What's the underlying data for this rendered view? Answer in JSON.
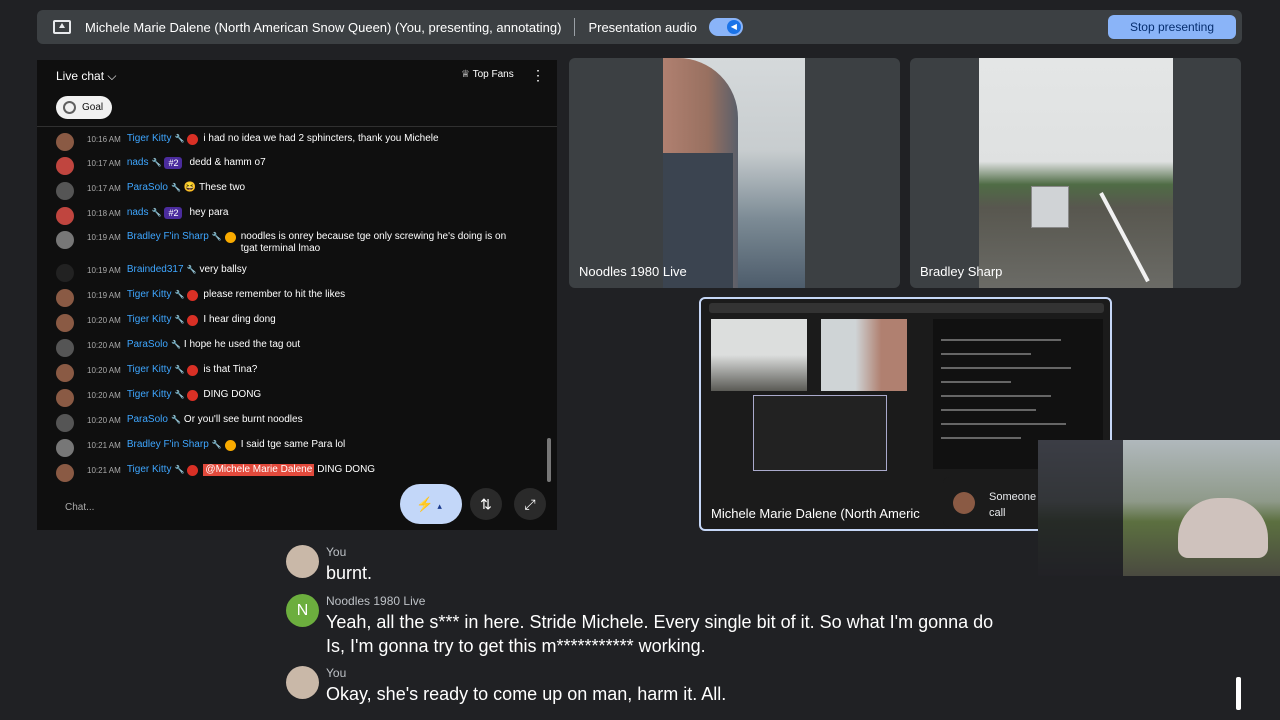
{
  "topbar": {
    "presenter_title": "Michele Marie Dalene (North American Snow Queen) (You, presenting, annotating)",
    "audio_label": "Presentation audio",
    "stop_button": "Stop presenting"
  },
  "chat": {
    "header": "Live chat",
    "top_fans": "Top Fans",
    "goal": "Goal",
    "input_placeholder": "Chat...",
    "messages": [
      {
        "time": "10:16 AM",
        "author": "Tiger Kitty",
        "text": "i had no idea we had 2 sphincters, thank you Michele",
        "badge": "red"
      },
      {
        "time": "10:17 AM",
        "author": "nads",
        "rank": "#2",
        "text": "dedd & hamm o7",
        "badge": "none"
      },
      {
        "time": "10:17 AM",
        "author": "ParaSolo",
        "text": "😆 These two",
        "badge": "none"
      },
      {
        "time": "10:18 AM",
        "author": "nads",
        "rank": "#2",
        "text": "hey para",
        "badge": "none"
      },
      {
        "time": "10:19 AM",
        "author": "Bradley F'in Sharp",
        "text": "noodles is onrey because tge only screwing he's doing is on tgat terminal lmao",
        "badge": "gold"
      },
      {
        "time": "10:19 AM",
        "author": "Brainded317",
        "text": "very ballsy",
        "badge": "none"
      },
      {
        "time": "10:19 AM",
        "author": "Tiger Kitty",
        "text": "please remember to hit the likes",
        "badge": "red"
      },
      {
        "time": "10:20 AM",
        "author": "Tiger Kitty",
        "text": "I hear ding dong",
        "badge": "red"
      },
      {
        "time": "10:20 AM",
        "author": "ParaSolo",
        "text": "I hope he used the tag out",
        "badge": "none"
      },
      {
        "time": "10:20 AM",
        "author": "Tiger Kitty",
        "text": "is that Tina?",
        "badge": "red"
      },
      {
        "time": "10:20 AM",
        "author": "Tiger Kitty",
        "text": "DING DONG",
        "badge": "red"
      },
      {
        "time": "10:20 AM",
        "author": "ParaSolo",
        "text": "Or you'll see burnt noodles",
        "badge": "none"
      },
      {
        "time": "10:21 AM",
        "author": "Bradley F'in Sharp",
        "text": "I said tge same Para lol",
        "badge": "gold"
      },
      {
        "time": "10:21 AM",
        "author": "Tiger Kitty",
        "mention": "@Michele Marie Dalene",
        "text": "DING DONG",
        "badge": "red"
      }
    ]
  },
  "tiles": {
    "tile1_name": "Noodles 1980 Live",
    "tile2_name": "Bradley Sharp",
    "screen_name": "Michele Marie Dalene (North Americ",
    "someone_text": "Someone call"
  },
  "captions": [
    {
      "speaker": "You",
      "text": "burnt."
    },
    {
      "speaker": "Noodles 1980 Live",
      "text": "Yeah, all the s*** in here. Stride Michele. Every single bit of it. So what I'm gonna do Is, I'm gonna try to get this m*********** working.",
      "initial": "N"
    },
    {
      "speaker": "You",
      "text": "Okay, she's ready to come up on man, harm it. All."
    }
  ]
}
